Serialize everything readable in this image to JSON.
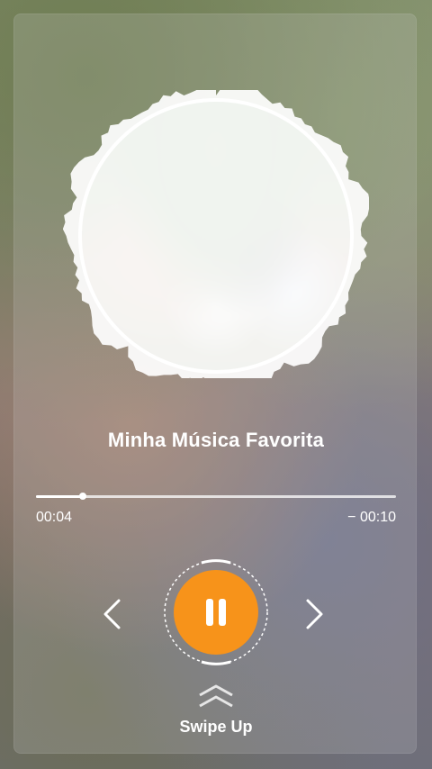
{
  "track": {
    "title": "Minha Música Favorita",
    "elapsed": "00:04",
    "remaining": "− 00:10",
    "progress_fraction": 0.13
  },
  "controls": {
    "previous_icon": "chevron-left-icon",
    "next_icon": "chevron-right-icon",
    "play_state_icon": "pause-icon",
    "accent_color": "#f7931a"
  },
  "cover": {
    "icon": "album-cover-photo",
    "frame_color": "#ffffff"
  },
  "swipe": {
    "icon": "double-chevron-up-icon",
    "label": "Swipe Up"
  }
}
